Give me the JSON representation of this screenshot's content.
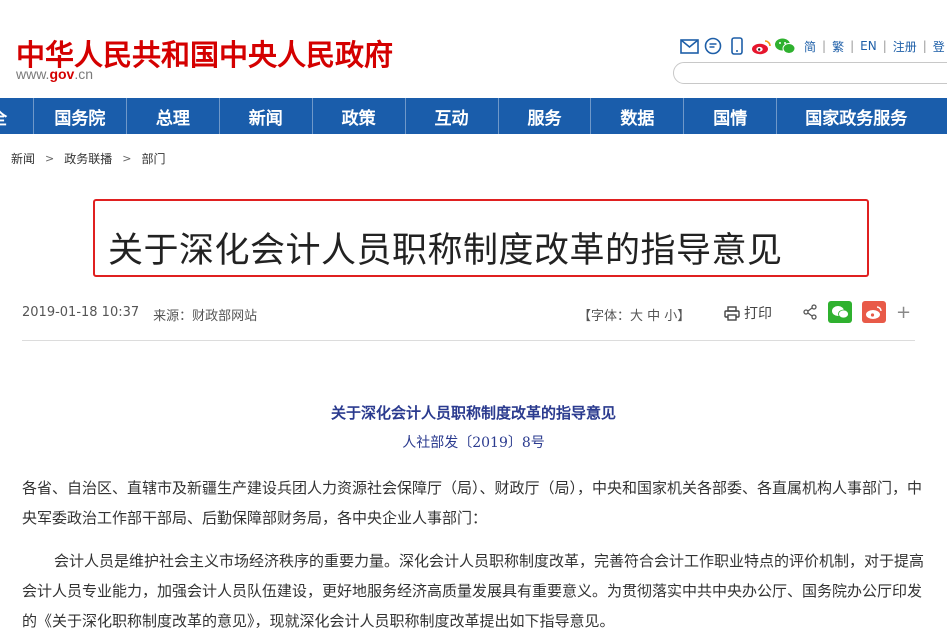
{
  "header": {
    "logo_text": "中华人民共和国中央人民政府",
    "url_prefix": "www.",
    "url_gov": "gov",
    "url_suffix": ".cn",
    "links": [
      "简",
      "繁",
      "EN",
      "注册",
      "登"
    ]
  },
  "nav": {
    "cut_label": "全",
    "items": [
      "国务院",
      "总理",
      "新闻",
      "政策",
      "互动",
      "服务",
      "数据",
      "国情",
      "国家政务服务"
    ]
  },
  "breadcrumb": [
    "新闻",
    "政务联播",
    "部门"
  ],
  "article": {
    "title": "关于深化会计人员职称制度改革的指导意见",
    "date": "2019-01-18 10:37",
    "source_label": "来源：",
    "source": "财政部网站",
    "font_ctrl": "【字体：大 中 小】",
    "print_label": "打印"
  },
  "document": {
    "title": "关于深化会计人员职称制度改革的指导意见",
    "number": "人社部发〔2019〕8号",
    "paragraphs": [
      "各省、自治区、直辖市及新疆生产建设兵团人力资源社会保障厅（局）、财政厅（局），中央和国家机关各部委、各直属机构人事部门，中央军委政治工作部干部局、后勤保障部财务局，各中央企业人事部门：",
      "会计人员是维护社会主义市场经济秩序的重要力量。深化会计人员职称制度改革，完善符合会计工作职业特点的评价机制，对于提高会计人员专业能力，加强会计人员队伍建设，更好地服务经济高质量发展具有重要意义。为贯彻落实中共中央办公厅、国务院办公厅印发的《关于深化职称制度改革的意见》，现就深化会计人员职称制度改革提出如下指导意见。"
    ]
  }
}
